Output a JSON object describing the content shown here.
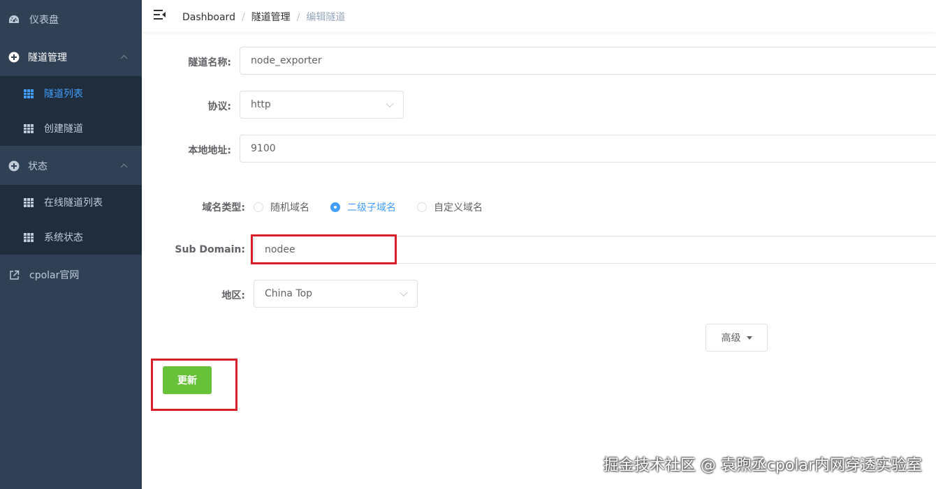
{
  "sidebar": {
    "items": [
      {
        "label": "仪表盘",
        "icon": "dashboard-icon"
      },
      {
        "label": "隧道管理",
        "icon": "circle-plus-icon"
      },
      {
        "label": "隧道列表",
        "icon": "grid-icon",
        "active": true
      },
      {
        "label": "创建隧道",
        "icon": "grid-icon"
      },
      {
        "label": "状态",
        "icon": "circle-plus-icon"
      },
      {
        "label": "在线隧道列表",
        "icon": "grid-icon"
      },
      {
        "label": "系统状态",
        "icon": "grid-icon"
      },
      {
        "label": "cpolar官网",
        "icon": "external-link-icon"
      }
    ]
  },
  "breadcrumb": {
    "items": [
      "Dashboard",
      "隧道管理",
      "编辑隧道"
    ]
  },
  "form": {
    "name_label": "隧道名称:",
    "name_value": "node_exporter",
    "protocol_label": "协议:",
    "protocol_value": "http",
    "local_label": "本地地址:",
    "local_value": "9100",
    "domain_type_label": "域名类型:",
    "domain_types": [
      "随机域名",
      "二级子域名",
      "自定义域名"
    ],
    "domain_type_selected": "二级子域名",
    "subdomain_label": "Sub Domain:",
    "subdomain_value": "nodee",
    "region_label": "地区:",
    "region_value": "China Top",
    "advanced_label": "高级",
    "update_label": "更新"
  },
  "colors": {
    "sidebar_bg": "#304156",
    "submenu_bg": "#1f2d3d",
    "accent": "#409eff",
    "success": "#67c23a",
    "highlight": "#d9202a"
  },
  "watermark": "掘金技术社区 @ 袁煦丞cpolar内网穿透实验室"
}
